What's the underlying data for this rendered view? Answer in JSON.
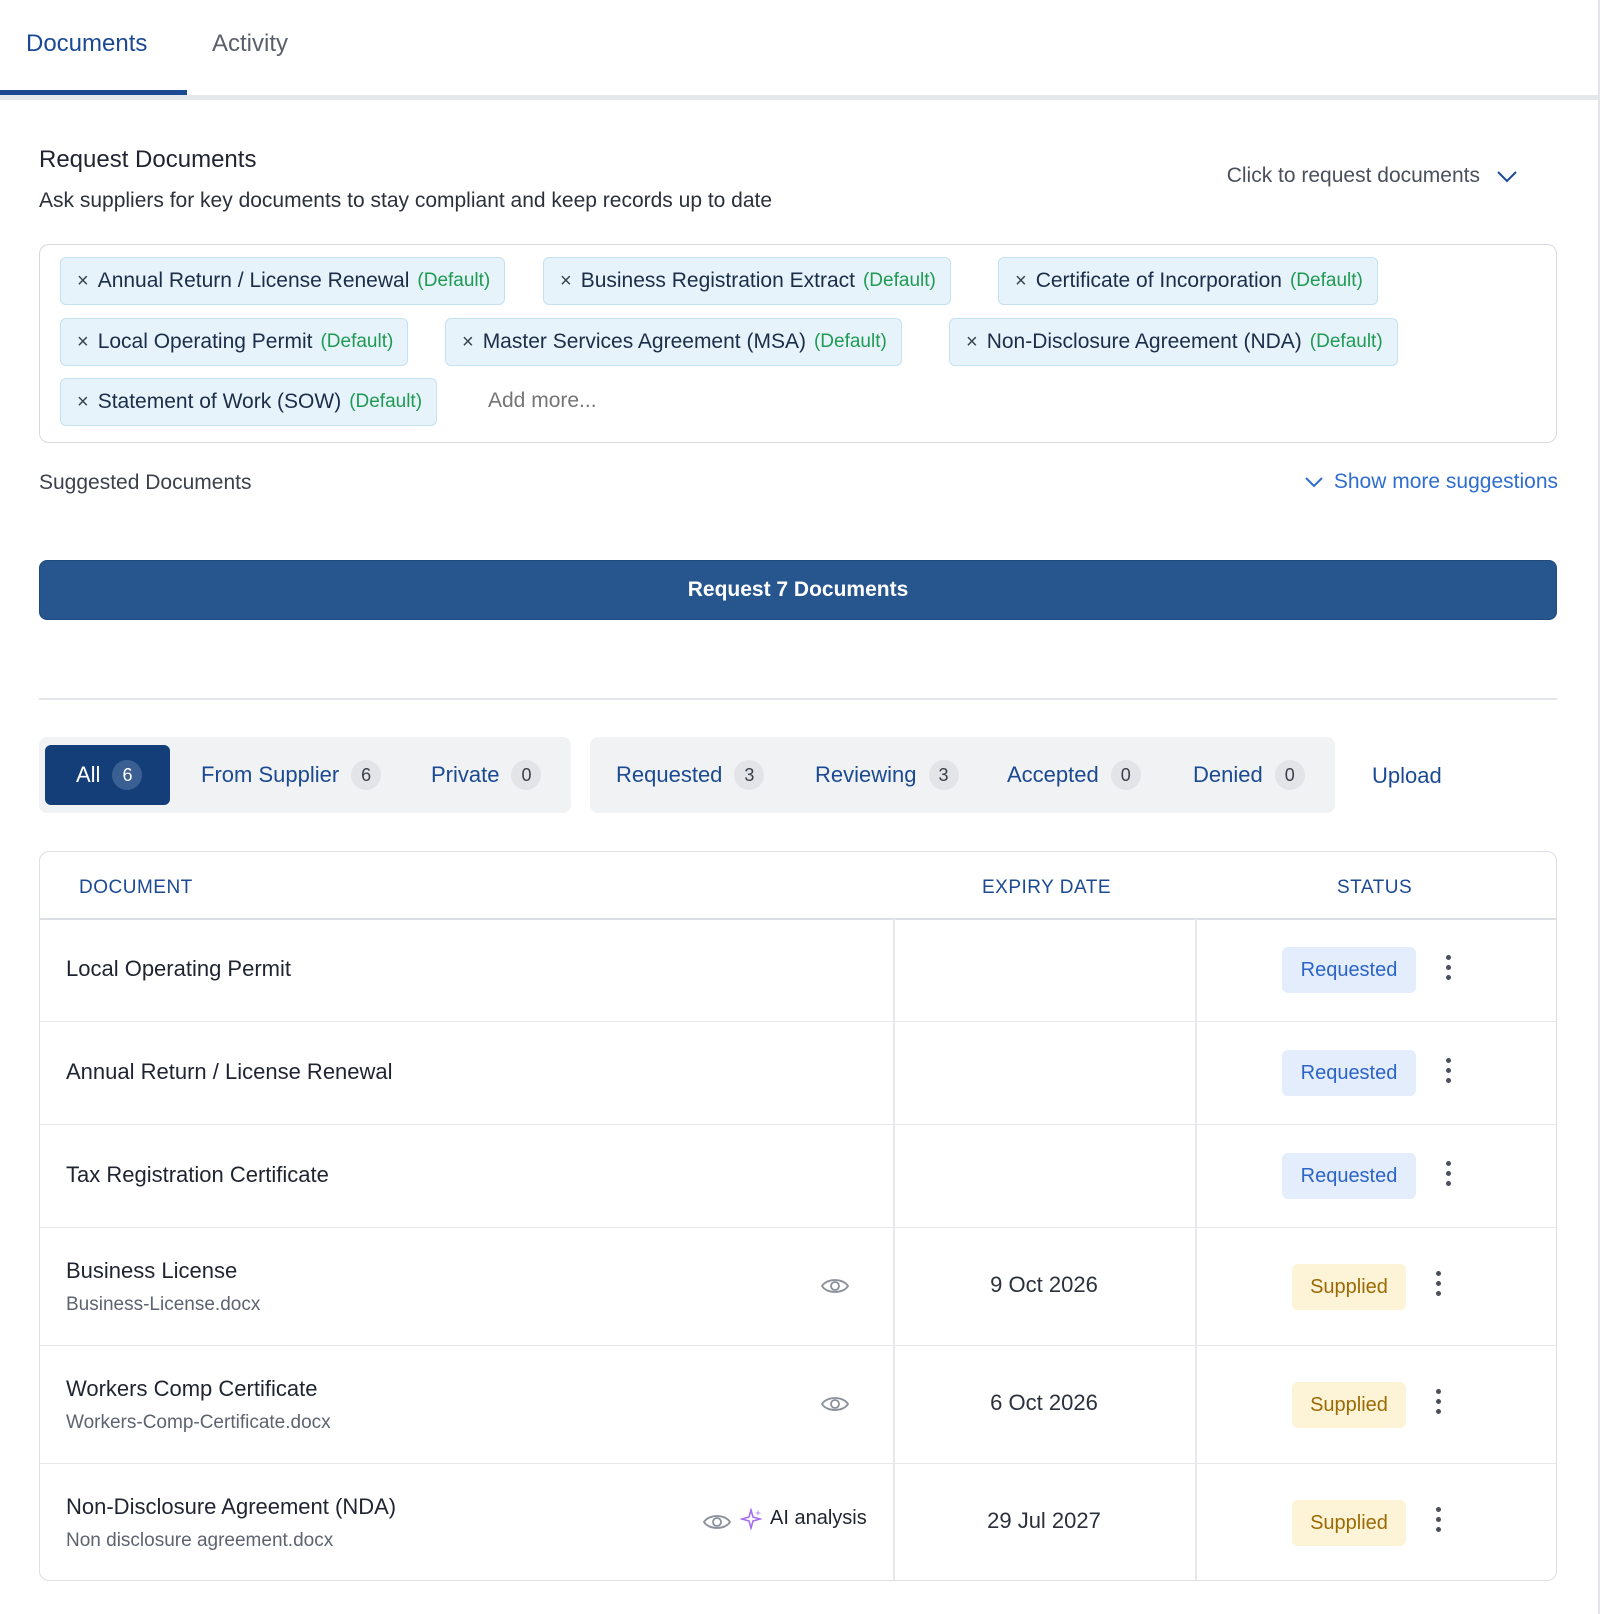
{
  "tabs": [
    {
      "label": "Documents",
      "active": true
    },
    {
      "label": "Activity",
      "active": false
    }
  ],
  "request": {
    "title": "Request Documents",
    "subtitle": "Ask suppliers for key documents to stay compliant and keep records up to date",
    "toggle_label": "Click to request documents",
    "chips": [
      {
        "label": "Annual Return / License Renewal",
        "tag": "(Default)"
      },
      {
        "label": "Business Registration Extract",
        "tag": "(Default)"
      },
      {
        "label": "Certificate of Incorporation",
        "tag": "(Default)"
      },
      {
        "label": "Local Operating Permit",
        "tag": "(Default)"
      },
      {
        "label": "Master Services Agreement (MSA)",
        "tag": "(Default)"
      },
      {
        "label": "Non-Disclosure Agreement (NDA)",
        "tag": "(Default)"
      },
      {
        "label": "Statement of Work (SOW)",
        "tag": "(Default)"
      }
    ],
    "chip_remove_glyph": "×",
    "add_placeholder": "Add more...",
    "suggested_label": "Suggested Documents",
    "show_more_label": "Show more suggestions",
    "button_label": "Request 7 Documents"
  },
  "filters": {
    "group1": [
      {
        "label": "All",
        "count": "6",
        "active": true
      },
      {
        "label": "From Supplier",
        "count": "6"
      },
      {
        "label": "Private",
        "count": "0"
      }
    ],
    "group2": [
      {
        "label": "Requested",
        "count": "3"
      },
      {
        "label": "Reviewing",
        "count": "3"
      },
      {
        "label": "Accepted",
        "count": "0"
      },
      {
        "label": "Denied",
        "count": "0"
      }
    ],
    "upload_label": "Upload"
  },
  "table": {
    "headers": {
      "document": "DOCUMENT",
      "expiry": "EXPIRY DATE",
      "status": "STATUS"
    },
    "rows": [
      {
        "name": "Local Operating Permit",
        "file": "",
        "expiry": "",
        "status": "Requested"
      },
      {
        "name": "Annual Return / License Renewal",
        "file": "",
        "expiry": "",
        "status": "Requested"
      },
      {
        "name": "Tax Registration Certificate",
        "file": "",
        "expiry": "",
        "status": "Requested"
      },
      {
        "name": "Business License",
        "file": "Business-License.docx",
        "expiry": "9 Oct 2026",
        "status": "Supplied"
      },
      {
        "name": "Workers Comp Certificate",
        "file": "Workers-Comp-Certificate.docx",
        "expiry": "6 Oct 2026",
        "status": "Supplied"
      },
      {
        "name": "Non-Disclosure Agreement (NDA)",
        "file": "Non disclosure agreement.docx",
        "expiry": "29 Jul 2027",
        "status": "Supplied",
        "ai_label": "AI analysis"
      }
    ]
  },
  "colors": {
    "primary": "#1b4a92",
    "button": "#27568f",
    "chip_bg": "#e7f3fb",
    "default_tag": "#1f9a52",
    "requested_bg": "#e3edfb",
    "supplied_bg": "#fdf3d6"
  },
  "icons": {
    "chip_remove": "close-icon",
    "toggle": "chevron-down-icon",
    "view": "eye-icon",
    "ai": "sparkle-icon",
    "row_menu": "kebab-menu-icon"
  }
}
